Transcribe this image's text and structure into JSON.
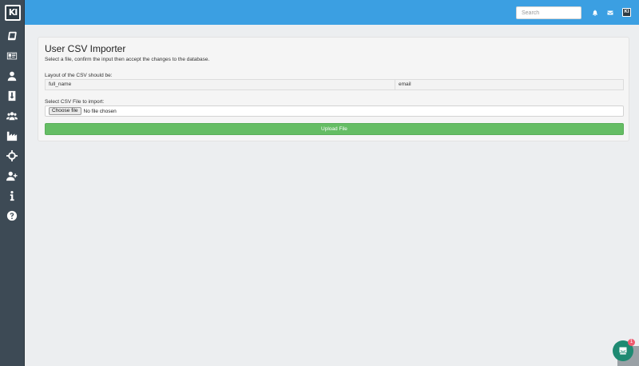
{
  "sidebar": {
    "logo_text": "KI",
    "items": [
      {
        "icon": "book-icon"
      },
      {
        "icon": "id-card-icon"
      },
      {
        "icon": "user-icon"
      },
      {
        "icon": "download-icon"
      },
      {
        "icon": "users-icon"
      },
      {
        "icon": "factory-icon"
      },
      {
        "icon": "crosshairs-icon"
      },
      {
        "icon": "user-plus-icon"
      },
      {
        "icon": "info-icon"
      },
      {
        "icon": "question-circle-icon"
      }
    ]
  },
  "topbar": {
    "search_placeholder": "Search",
    "avatar_text": "KI",
    "accent_color": "#3b9fe2"
  },
  "importer": {
    "title": "User CSV Importer",
    "subtitle": "Select a file, confirm the input then accept the changes to the database.",
    "layout_label": "Layout of the CSV should be:",
    "columns": [
      "full_name",
      "email"
    ],
    "file_label": "Select CSV File to import:",
    "choose_label": "Choose file",
    "file_status": "No file chosen",
    "upload_label": "Upload File",
    "upload_color": "#65bd64"
  },
  "chat": {
    "badge_count": "1"
  }
}
